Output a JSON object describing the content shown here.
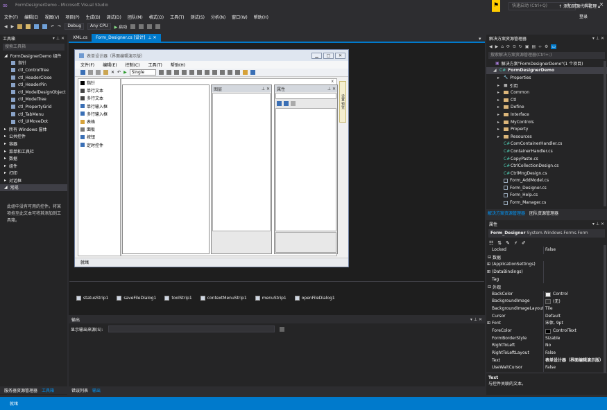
{
  "title_bar": {
    "title": "FormDesignerDemo - Microsoft Visual Studio",
    "quick_launch_placeholder": "快速启动 (Ctrl+Q)",
    "sign_in": "登录"
  },
  "menu": [
    "文件(F)",
    "编辑(E)",
    "视图(V)",
    "项目(P)",
    "生成(B)",
    "调试(D)",
    "团队(M)",
    "格式(O)",
    "工具(T)",
    "测试(S)",
    "分析(N)",
    "窗口(W)",
    "帮助(H)"
  ],
  "toolbar": {
    "config": "Debug",
    "platform": "Any CPU",
    "start": "启动"
  },
  "toolbox": {
    "title": "工具箱",
    "search_placeholder": "搜索工具箱",
    "items": [
      {
        "label": "FormDesignerDemo 组件",
        "level": 0,
        "expanded": true
      },
      {
        "label": "指针",
        "level": 1
      },
      {
        "label": "ctl_ControlTree",
        "level": 1
      },
      {
        "label": "ctl_HeaderClose",
        "level": 1
      },
      {
        "label": "ctl_HeaderPin",
        "level": 1
      },
      {
        "label": "ctl_ModelDesignObject",
        "level": 1
      },
      {
        "label": "ctl_ModelTree",
        "level": 1
      },
      {
        "label": "ctl_PropertyGrid",
        "level": 1
      },
      {
        "label": "ctl_TabMenu",
        "level": 1
      },
      {
        "label": "ctl_UIMoveDot",
        "level": 1
      },
      {
        "label": "所有 Windows 窗体",
        "level": 0
      },
      {
        "label": "公共控件",
        "level": 0
      },
      {
        "label": "容器",
        "level": 0
      },
      {
        "label": "菜单和工具栏",
        "level": 0
      },
      {
        "label": "数据",
        "level": 0
      },
      {
        "label": "组件",
        "level": 0
      },
      {
        "label": "打印",
        "level": 0
      },
      {
        "label": "对话框",
        "level": 0
      },
      {
        "label": "常规",
        "level": 0,
        "expanded": true,
        "selected": true
      }
    ],
    "note": "此组中没有可用的控件。将某项拖至此文本可将其添加到工具箱。",
    "bottom_tabs": [
      "服务器资源管理器",
      "工具箱"
    ]
  },
  "doc_tabs": [
    {
      "label": "XML.cs",
      "active": false
    },
    {
      "label": "Form_Designer.cs [设计]",
      "active": true
    }
  ],
  "form": {
    "title": "表单设计器（界面编辑演示版）",
    "menu": [
      "文件(F)",
      "编辑(E)",
      "控制(C)",
      "工具(T)",
      "帮助(H)"
    ],
    "zoom_select": "Single",
    "toolbox_items": [
      "指针",
      "单行文本",
      "多行文本",
      "单行输入框",
      "多行输入框",
      "表格",
      "面板",
      "按钮",
      "定时控件"
    ],
    "layer_panel": "图层",
    "prop_panel": "属性",
    "side_tab": "设置 预览",
    "status": "就绪",
    "close_x": "x"
  },
  "tray": [
    "statusStrip1",
    "saveFileDialog1",
    "toolStrip1",
    "contextMenuStrip1",
    "menuStrip1",
    "openFileDialog1"
  ],
  "output": {
    "title": "输出",
    "show_from": "显示输出来源(S):",
    "tabs": [
      "错误列表",
      "输出"
    ]
  },
  "solution_explorer": {
    "title": "解决方案资源管理器",
    "search_placeholder": "搜索解决方案资源管理器(Ctrl+;)",
    "items": [
      {
        "label": "解决方案\"FormDesignerDemo\"(1 个项目)",
        "indent": 0,
        "kind": "sln"
      },
      {
        "label": "FormDesignerDemo",
        "indent": 1,
        "kind": "proj",
        "selected": true
      },
      {
        "label": "Properties",
        "indent": 2,
        "kind": "wrench"
      },
      {
        "label": "引用",
        "indent": 2,
        "kind": "ref"
      },
      {
        "label": "Common",
        "indent": 2,
        "kind": "folder"
      },
      {
        "label": "Ctl",
        "indent": 2,
        "kind": "folder"
      },
      {
        "label": "Define",
        "indent": 2,
        "kind": "folder"
      },
      {
        "label": "Interface",
        "indent": 2,
        "kind": "folder"
      },
      {
        "label": "MyControls",
        "indent": 2,
        "kind": "folder"
      },
      {
        "label": "Property",
        "indent": 2,
        "kind": "folder"
      },
      {
        "label": "Resources",
        "indent": 2,
        "kind": "folder"
      },
      {
        "label": "ComContainerHandler.cs",
        "indent": 2,
        "kind": "cs"
      },
      {
        "label": "ContainerHandler.cs",
        "indent": 2,
        "kind": "cs"
      },
      {
        "label": "CopyPaste.cs",
        "indent": 2,
        "kind": "cs"
      },
      {
        "label": "CtrlCollectionDesign.cs",
        "indent": 2,
        "kind": "cs"
      },
      {
        "label": "CtrlMngDesign.cs",
        "indent": 2,
        "kind": "cs"
      },
      {
        "label": "Form_AddModel.cs",
        "indent": 2,
        "kind": "form"
      },
      {
        "label": "Form_Designer.cs",
        "indent": 2,
        "kind": "form"
      },
      {
        "label": "Form_Help.cs",
        "indent": 2,
        "kind": "form"
      },
      {
        "label": "Form_Manager.cs",
        "indent": 2,
        "kind": "form"
      }
    ],
    "bottom_tabs": [
      "解决方案资源管理器",
      "团队资源管理器"
    ]
  },
  "properties": {
    "title": "属性",
    "object": "Form_Designer",
    "object_type": "System.Windows.Forms.Form",
    "rows": [
      {
        "name": "Locked",
        "value": "False"
      },
      {
        "name": "数据",
        "cat": true
      },
      {
        "name": "(ApplicationSettings)",
        "value": "",
        "exp": true
      },
      {
        "name": "(DataBindings)",
        "value": "",
        "exp": true
      },
      {
        "name": "Tag",
        "value": ""
      },
      {
        "name": "外观",
        "cat": true
      },
      {
        "name": "BackColor",
        "value": "Control",
        "swatch": "#f0f0f0"
      },
      {
        "name": "BackgroundImage",
        "value": "(无)",
        "swatch": "#333333"
      },
      {
        "name": "BackgroundImageLayout",
        "value": "Tile"
      },
      {
        "name": "Cursor",
        "value": "Default"
      },
      {
        "name": "Font",
        "value": "宋体, 9pt",
        "exp": true
      },
      {
        "name": "ForeColor",
        "value": "ControlText",
        "swatch": "#000000"
      },
      {
        "name": "FormBorderStyle",
        "value": "Sizable"
      },
      {
        "name": "RightToLeft",
        "value": "No"
      },
      {
        "name": "RightToLeftLayout",
        "value": "False"
      },
      {
        "name": "Text",
        "value": "表单设计器（界面编辑演示版）",
        "bold": true
      },
      {
        "name": "UseWaitCursor",
        "value": "False"
      }
    ],
    "desc_title": "Text",
    "desc_text": "与控件关联的文本。"
  },
  "status_bar": {
    "text": "就绪",
    "right": "添加到源代码管理"
  },
  "colors": {
    "accent": "#007acc",
    "notif": "#ffcc00"
  }
}
